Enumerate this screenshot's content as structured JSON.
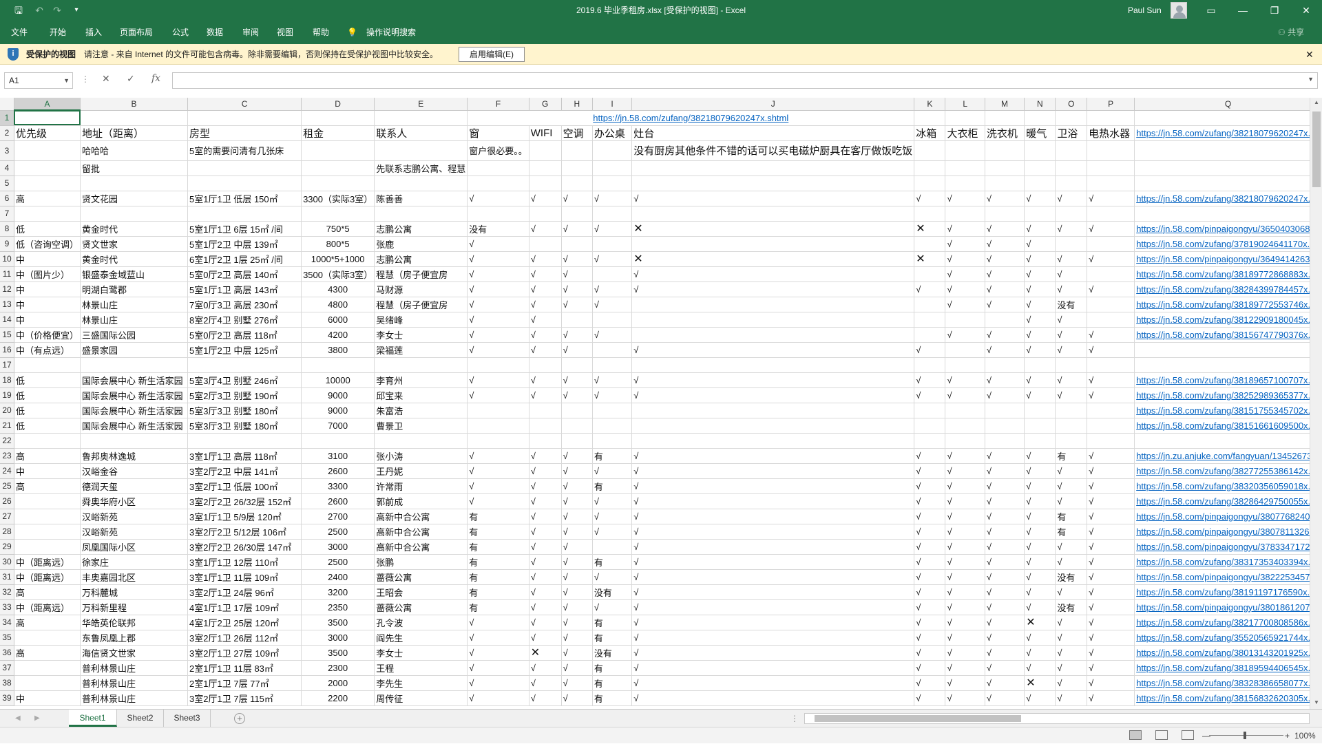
{
  "window": {
    "title": "2019.6 毕业季租房.xlsx  [受保护的视图]  -  Excel",
    "user": "Paul Sun",
    "qa_icons": [
      "save-icon",
      "undo-icon",
      "redo-icon",
      "customize-icon"
    ],
    "controls": [
      "□",
      "—",
      "❐",
      "✕"
    ]
  },
  "ribbon": {
    "tabs": [
      "文件",
      "开始",
      "插入",
      "页面布局",
      "公式",
      "数据",
      "审阅",
      "视图",
      "帮助",
      "操作说明搜索"
    ],
    "share": "共享"
  },
  "protected_view": {
    "title": "受保护的视图",
    "message": "请注意 - 来自 Internet 的文件可能包含病毒。除非需要编辑，否则保持在受保护视图中比较安全。",
    "button": "启用编辑(E)",
    "close": "✕"
  },
  "formula_bar": {
    "name_box": "A1",
    "value": ""
  },
  "columns": [
    "A",
    "B",
    "C",
    "D",
    "E",
    "F",
    "G",
    "H",
    "I",
    "J",
    "K",
    "L",
    "M",
    "N",
    "O",
    "P",
    "Q"
  ],
  "rows": [
    {
      "n": "1",
      "cells": [
        "",
        "",
        "",
        "",
        "",
        "https://jn.58.com/zufang/38218079620247x.shtml",
        "",
        "",
        "",
        "",
        "",
        "",
        "",
        "",
        "",
        "",
        ""
      ]
    },
    {
      "n": "2",
      "cells": [
        "优先级",
        "地址（距离）",
        "房型",
        "租金",
        "联系人",
        "窗",
        "WIFI",
        "空调",
        "办公桌",
        "灶台",
        "冰箱",
        "大衣柜",
        "洗衣机",
        "暖气",
        "卫浴",
        "电热水器",
        "https://jn.58.com/zufang/38218079620247x.sh"
      ]
    },
    {
      "n": "3",
      "cells": [
        "",
        "哈哈哈",
        "5室的需要问清有几张床",
        "",
        "",
        "窗户很必要。。",
        "",
        "",
        "",
        "没有厨房其他条件不错的话可以买电磁炉厨具在客厅做饭吃饭",
        "",
        "",
        "",
        "",
        "",
        "",
        ""
      ]
    },
    {
      "n": "4",
      "cells": [
        "",
        "留批",
        "",
        "",
        "先联系志鹏公寓、程慧",
        "",
        "",
        "",
        "",
        "",
        "",
        "",
        "",
        "",
        "",
        "",
        ""
      ]
    },
    {
      "n": "5",
      "cells": [
        "",
        "",
        "",
        "",
        "",
        "",
        "",
        "",
        "",
        "",
        "",
        "",
        "",
        "",
        "",
        "",
        ""
      ]
    },
    {
      "n": "6",
      "cells": [
        "高",
        "贤文花园",
        "5室1厅1卫 低层 150㎡",
        "3300（实际3室）",
        "陈善善",
        "√",
        "√",
        "√",
        "√",
        "√",
        "√",
        "√",
        "√",
        "√",
        "√",
        "√",
        "https://jn.58.com/zufang/38218079620247x.sh"
      ]
    },
    {
      "n": "7",
      "cells": [
        "",
        "",
        "",
        "",
        "",
        "",
        "",
        "",
        "",
        "",
        "",
        "",
        "",
        "",
        "",
        "",
        ""
      ]
    },
    {
      "n": "8",
      "cells": [
        "低",
        "黄金时代",
        "5室1厅1卫 6层 15㎡ /间",
        "750*5",
        "志鹏公寓",
        "没有",
        "√",
        "√",
        "√",
        "✕",
        "✕",
        "√",
        "√",
        "√",
        "√",
        "√",
        "https://jn.58.com/pinpaigongyu/365040306836"
      ]
    },
    {
      "n": "9",
      "cells": [
        "低（咨询空调）",
        "贤文世家",
        "5室1厅2卫 中层 139㎡",
        "800*5",
        "张鹿",
        "√",
        "",
        "",
        "",
        "",
        "",
        "√",
        "√",
        "√",
        "",
        "",
        "https://jn.58.com/zufang/37819024641170x.sh"
      ]
    },
    {
      "n": "10",
      "cells": [
        "中",
        "黄金时代",
        "6室1厅2卫 1层 25㎡ /间",
        "1000*5+1000",
        "志鹏公寓",
        "√",
        "√",
        "√",
        "√",
        "✕",
        "✕",
        "√",
        "√",
        "√",
        "√",
        "√",
        "https://jn.58.com/pinpaigongyu/364941426368"
      ]
    },
    {
      "n": "11",
      "cells": [
        "中（图片少）",
        "银盛泰金域蓝山",
        "5室0厅2卫 高层 140㎡",
        "3500（实际3室）",
        "程慧（房子便宜房",
        "√",
        "√",
        "√",
        "",
        "√",
        "",
        "√",
        "√",
        "√",
        "√",
        "",
        "https://jn.58.com/zufang/38189772868883x.sh"
      ]
    },
    {
      "n": "12",
      "cells": [
        "中",
        "明湖白鹭郡",
        "5室1厅1卫 高层 143㎡",
        "4300",
        "马财源",
        "√",
        "√",
        "√",
        "√",
        "√",
        "√",
        "√",
        "√",
        "√",
        "√",
        "√",
        "https://jn.58.com/zufang/38284399784457x.sh"
      ]
    },
    {
      "n": "13",
      "cells": [
        "中",
        "林景山庄",
        "7室0厅3卫 高层 230㎡",
        "4800",
        "程慧（房子便宜房",
        "√",
        "√",
        "√",
        "√",
        "",
        "",
        "√",
        "√",
        "√",
        "没有",
        "",
        "https://jn.58.com/zufang/38189772553746x.sh"
      ]
    },
    {
      "n": "14",
      "cells": [
        "中",
        "林景山庄",
        "8室2厅4卫 别墅 276㎡",
        "6000",
        "吴绪峰",
        "√",
        "√",
        "",
        "",
        "",
        "",
        "",
        "",
        "√",
        "√",
        "",
        "https://jn.58.com/zufang/38122909180045x.sh"
      ]
    },
    {
      "n": "15",
      "cells": [
        "中（价格便宜）",
        "三盛国际公园",
        "5室0厅2卫 高层 118㎡",
        "4200",
        "李女士",
        "√",
        "√",
        "√",
        "√",
        "",
        "",
        "√",
        "√",
        "√",
        "√",
        "√",
        "https://jn.58.com/zufang/38156747790376x.sh"
      ]
    },
    {
      "n": "16",
      "cells": [
        "中（有点远）",
        "盛景家园",
        "5室1厅2卫 中层 125㎡",
        "3800",
        "梁福莲",
        "√",
        "√",
        "√",
        "",
        "√",
        "√",
        "",
        "√",
        "√",
        "√",
        "√",
        ""
      ]
    },
    {
      "n": "17",
      "cells": [
        "",
        "",
        "",
        "",
        "",
        "",
        "",
        "",
        "",
        "",
        "",
        "",
        "",
        "",
        "",
        "",
        ""
      ]
    },
    {
      "n": "18",
      "cells": [
        "低",
        "国际会展中心 新生活家园",
        "5室3厅4卫 别墅 246㎡",
        "10000",
        "李育州",
        "√",
        "√",
        "√",
        "√",
        "√",
        "√",
        "√",
        "√",
        "√",
        "√",
        "√",
        "https://jn.58.com/zufang/38189657100707x.sh"
      ]
    },
    {
      "n": "19",
      "cells": [
        "低",
        "国际会展中心 新生活家园",
        "5室2厅3卫 别墅 190㎡",
        "9000",
        "邱宝来",
        "√",
        "√",
        "√",
        "√",
        "√",
        "√",
        "√",
        "√",
        "√",
        "√",
        "√",
        "https://jn.58.com/zufang/38252989365377x.sh"
      ]
    },
    {
      "n": "20",
      "cells": [
        "低",
        "国际会展中心 新生活家园",
        "5室3厅3卫 别墅 180㎡",
        "9000",
        "朱富浩",
        "",
        "",
        "",
        "",
        "",
        "",
        "",
        "",
        "",
        "",
        "",
        "https://jn.58.com/zufang/38151755345702x.sh"
      ]
    },
    {
      "n": "21",
      "cells": [
        "低",
        "国际会展中心 新生活家园",
        "5室3厅3卫 别墅 180㎡",
        "7000",
        "曹景卫",
        "",
        "",
        "",
        "",
        "",
        "",
        "",
        "",
        "",
        "",
        "",
        "https://jn.58.com/zufang/38151661609500x.sh"
      ]
    },
    {
      "n": "22",
      "cells": [
        "",
        "",
        "",
        "",
        "",
        "",
        "",
        "",
        "",
        "",
        "",
        "",
        "",
        "",
        "",
        "",
        ""
      ]
    },
    {
      "n": "23",
      "cells": [
        "高",
        "鲁邦奥林逸城",
        "3室1厅1卫 高层 118㎡",
        "3100",
        "张小涛",
        "√",
        "√",
        "√",
        "有",
        "√",
        "√",
        "√",
        "√",
        "√",
        "有",
        "√",
        "https://jn.zu.anjuke.com/fangyuan/134526738"
      ]
    },
    {
      "n": "24",
      "cells": [
        "中",
        "汉峪金谷",
        "3室2厅2卫 中层 141㎡",
        "2600",
        "王丹妮",
        "√",
        "√",
        "√",
        "√",
        "√",
        "√",
        "√",
        "√",
        "√",
        "√",
        "√",
        "https://jn.58.com/zufang/38277255386142x.sh"
      ]
    },
    {
      "n": "25",
      "cells": [
        "高",
        "德润天玺",
        "3室2厅1卫 低层 100㎡",
        "3300",
        "许常雨",
        "√",
        "√",
        "√",
        "有",
        "√",
        "√",
        "√",
        "√",
        "√",
        "√",
        "√",
        "https://jn.58.com/zufang/38320356059018x.sh"
      ]
    },
    {
      "n": "26",
      "cells": [
        "",
        "舜奥华府小区",
        "3室2厅2卫 26/32层 152㎡",
        "2600",
        "郭前成",
        "√",
        "√",
        "√",
        "√",
        "√",
        "√",
        "√",
        "√",
        "√",
        "√",
        "√",
        "https://jn.58.com/zufang/38286429750055x.sh"
      ]
    },
    {
      "n": "27",
      "cells": [
        "",
        "汉峪新苑",
        "3室1厅1卫 5/9层 120㎡",
        "2700",
        "高新中合公寓",
        "有",
        "√",
        "√",
        "√",
        "√",
        "√",
        "√",
        "√",
        "√",
        "有",
        "√",
        "https://jn.58.com/pinpaigongyu/380776824045"
      ]
    },
    {
      "n": "28",
      "cells": [
        "",
        "汉峪新苑",
        "3室2厅2卫 5/12层 106㎡",
        "2500",
        "高新中合公寓",
        "有",
        "√",
        "√",
        "√",
        "√",
        "√",
        "√",
        "√",
        "√",
        "有",
        "√",
        "https://jn.58.com/pinpaigongyu/380781132677"
      ]
    },
    {
      "n": "29",
      "cells": [
        "",
        "凤凰国际小区",
        "3室2厅2卫 26/30层 147㎡",
        "3000",
        "高新中合公寓",
        "有",
        "√",
        "√",
        "",
        "√",
        "√",
        "√",
        "√",
        "√",
        "√",
        "√",
        "https://jn.58.com/pinpaigongyu/378334717249"
      ]
    },
    {
      "n": "30",
      "cells": [
        "中（距离远）",
        "徐家庄",
        "3室1厅1卫 12层 110㎡",
        "2500",
        "张鹏",
        "有",
        "√",
        "√",
        "有",
        "√",
        "√",
        "√",
        "√",
        "√",
        "√",
        "√",
        "https://jn.58.com/zufang/38317353403394x.sh"
      ]
    },
    {
      "n": "31",
      "cells": [
        "中（距离远）",
        "丰奥嘉园北区",
        "3室1厅1卫 11层 109㎡",
        "2400",
        "蔷薇公寓",
        "有",
        "√",
        "√",
        "√",
        "√",
        "√",
        "√",
        "√",
        "√",
        "没有",
        "√",
        "https://jn.58.com/pinpaigongyu/382225345719"
      ]
    },
    {
      "n": "32",
      "cells": [
        "高",
        "万科麓城",
        "3室2厅1卫 24层 96㎡",
        "3200",
        "王昭会",
        "有",
        "√",
        "√",
        "没有",
        "√",
        "√",
        "√",
        "√",
        "√",
        "√",
        "√",
        "https://jn.58.com/zufang/38191197176590x.sh"
      ]
    },
    {
      "n": "33",
      "cells": [
        "中（距离远）",
        "万科新里程",
        "4室1厅1卫 17层 109㎡",
        "2350",
        "蔷薇公寓",
        "有",
        "√",
        "√",
        "√",
        "√",
        "√",
        "√",
        "√",
        "√",
        "没有",
        "√",
        "https://jn.58.com/pinpaigongyu/380186120774"
      ]
    },
    {
      "n": "34",
      "cells": [
        "高",
        "华皓英伦联邦",
        "4室1厅2卫 25层 120㎡",
        "3500",
        "孔令波",
        "√",
        "√",
        "√",
        "有",
        "√",
        "√",
        "√",
        "√",
        "✕",
        "√",
        "√",
        "https://jn.58.com/zufang/38217700808586x.sh"
      ]
    },
    {
      "n": "35",
      "cells": [
        "",
        "东鲁凤凰上郡",
        "3室2厅1卫 26层 112㎡",
        "3000",
        "阎先生",
        "√",
        "√",
        "√",
        "有",
        "√",
        "√",
        "√",
        "√",
        "√",
        "√",
        "√",
        "https://jn.58.com/zufang/35520565921744x.sh"
      ]
    },
    {
      "n": "36",
      "cells": [
        "高",
        "海信贤文世家",
        "3室2厅1卫 27层 109㎡",
        "3500",
        "李女士",
        "√",
        "✕",
        "√",
        "没有",
        "√",
        "√",
        "√",
        "√",
        "√",
        "√",
        "√",
        "https://jn.58.com/zufang/38013143201925x.sh"
      ]
    },
    {
      "n": "37",
      "cells": [
        "",
        "普利林景山庄",
        "2室1厅1卫 11层 83㎡",
        "2300",
        "王程",
        "√",
        "√",
        "√",
        "有",
        "√",
        "√",
        "√",
        "√",
        "√",
        "√",
        "√",
        "https://jn.58.com/zufang/38189594406545x.sh"
      ]
    },
    {
      "n": "38",
      "cells": [
        "",
        "普利林景山庄",
        "2室1厅1卫 7层 77㎡",
        "2000",
        "李先生",
        "√",
        "√",
        "√",
        "有",
        "√",
        "√",
        "√",
        "√",
        "✕",
        "√",
        "√",
        "https://jn.58.com/zufang/38328386658077x.sh"
      ]
    },
    {
      "n": "39",
      "cells": [
        "中",
        "普利林景山庄",
        "3室2厅1卫 7层 115㎡",
        "2200",
        "周传征",
        "√",
        "√",
        "√",
        "有",
        "√",
        "√",
        "√",
        "√",
        "√",
        "√",
        "√",
        "https://jn.58.com/zufang/38156832620305x.sh"
      ]
    }
  ],
  "sheets": [
    "Sheet1",
    "Sheet2",
    "Sheet3"
  ],
  "active_sheet": "Sheet1",
  "status": {
    "zoom": "100%",
    "minus": "—",
    "plus": "+"
  }
}
